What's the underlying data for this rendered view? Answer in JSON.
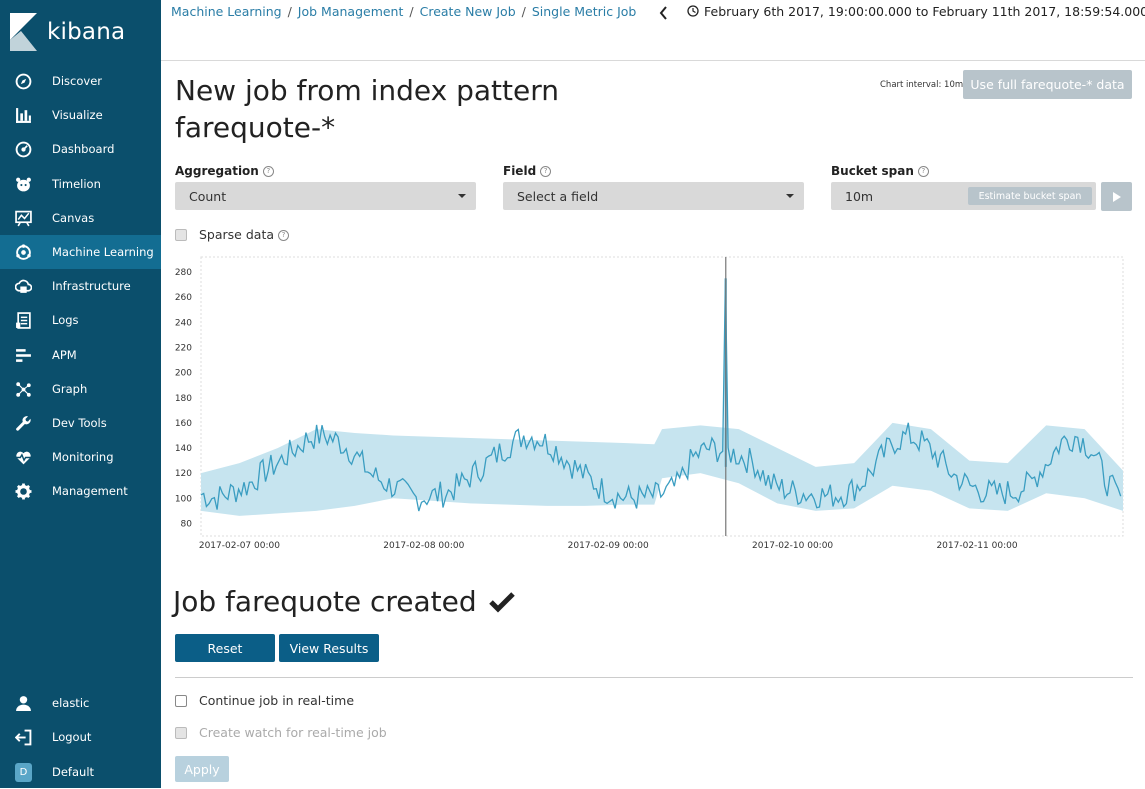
{
  "app": {
    "logo_text": "kibana"
  },
  "sidebar": {
    "items": [
      {
        "label": "Discover",
        "icon": "compass-icon"
      },
      {
        "label": "Visualize",
        "icon": "bar-chart-icon"
      },
      {
        "label": "Dashboard",
        "icon": "dashboard-icon"
      },
      {
        "label": "Timelion",
        "icon": "timelion-icon"
      },
      {
        "label": "Canvas",
        "icon": "canvas-icon"
      },
      {
        "label": "Machine Learning",
        "icon": "machine-learning-icon",
        "active": true
      },
      {
        "label": "Infrastructure",
        "icon": "infrastructure-icon"
      },
      {
        "label": "Logs",
        "icon": "logs-icon"
      },
      {
        "label": "APM",
        "icon": "apm-icon"
      },
      {
        "label": "Graph",
        "icon": "graph-icon"
      },
      {
        "label": "Dev Tools",
        "icon": "wrench-icon"
      },
      {
        "label": "Monitoring",
        "icon": "heartbeat-icon"
      },
      {
        "label": "Management",
        "icon": "gear-icon"
      }
    ],
    "bottom": [
      {
        "label": "elastic",
        "icon": "user-icon"
      },
      {
        "label": "Logout",
        "icon": "logout-icon"
      },
      {
        "label": "Default",
        "icon": "space-avatar",
        "avatar_letter": "D"
      }
    ]
  },
  "breadcrumb": {
    "items": [
      "Machine Learning",
      "Job Management",
      "Create New Job",
      "Single Metric Job"
    ],
    "separator": "/"
  },
  "time_picker": {
    "range": "February 6th 2017, 19:00:00.000 to February 11th 2017, 18:59:54.000"
  },
  "page": {
    "title": "New job from index pattern farequote-*",
    "chart_interval": "Chart interval: 10m",
    "use_full_button": "Use full farequote-* data"
  },
  "form": {
    "aggregation": {
      "label": "Aggregation",
      "value": "Count"
    },
    "field": {
      "label": "Field",
      "value": "Select a field"
    },
    "bucket_span": {
      "label": "Bucket span",
      "value": "10m",
      "estimate_button": "Estimate bucket span"
    },
    "sparse_data": {
      "label": "Sparse data",
      "checked": false
    }
  },
  "chart_data": {
    "type": "line",
    "x_tick_labels": [
      "2017-02-07 00:00",
      "2017-02-08 00:00",
      "2017-02-09 00:00",
      "2017-02-10 00:00",
      "2017-02-11 00:00"
    ],
    "y_ticks": [
      80,
      100,
      120,
      140,
      160,
      180,
      200,
      220,
      240,
      260,
      280
    ],
    "ylim": [
      70,
      292
    ],
    "xlim_hours": [
      -5,
      115
    ],
    "series_hours": [
      -5,
      -3,
      -1,
      1,
      3,
      5,
      7,
      9,
      11,
      13,
      15,
      17,
      19,
      21,
      23,
      25,
      27,
      29,
      31,
      33,
      35,
      37,
      39,
      41,
      43,
      45,
      47,
      49,
      51,
      53,
      55,
      57,
      59,
      61,
      63,
      65,
      67,
      69,
      71,
      73,
      75,
      77,
      79,
      81,
      83,
      85,
      87,
      89,
      91,
      93,
      95,
      97,
      99,
      101,
      103,
      105,
      107,
      109,
      111,
      113,
      115
    ],
    "series_values": [
      103,
      100,
      105,
      110,
      120,
      128,
      138,
      148,
      150,
      145,
      135,
      120,
      112,
      106,
      100,
      102,
      104,
      112,
      122,
      132,
      142,
      150,
      148,
      140,
      128,
      118,
      108,
      102,
      100,
      101,
      103,
      110,
      132,
      140,
      138,
      134,
      128,
      112,
      107,
      104,
      103,
      102,
      104,
      112,
      128,
      144,
      150,
      144,
      132,
      118,
      110,
      105,
      104,
      106,
      112,
      128,
      145,
      150,
      138,
      112,
      98
    ],
    "spike": {
      "hour": 63.3,
      "value": 275
    },
    "band_hours": [
      -5,
      0,
      5,
      10,
      15,
      20,
      25,
      30,
      35,
      40,
      45,
      50,
      54,
      55,
      60,
      65,
      70,
      75,
      80,
      85,
      90,
      95,
      100,
      105,
      110,
      115
    ],
    "band_upper": [
      120,
      128,
      140,
      155,
      152,
      150,
      149,
      148,
      147,
      146,
      145,
      144,
      143,
      155,
      158,
      155,
      140,
      125,
      128,
      160,
      155,
      130,
      128,
      158,
      155,
      122
    ],
    "band_lower": [
      90,
      86,
      88,
      90,
      94,
      100,
      98,
      96,
      95,
      94,
      94,
      95,
      95,
      116,
      120,
      112,
      96,
      90,
      92,
      110,
      106,
      92,
      90,
      104,
      100,
      90
    ],
    "marker_hour": 63.3,
    "colors": {
      "line": "#3a9dc1",
      "band": "#c6e4ef",
      "marker": "#777777"
    }
  },
  "result": {
    "created_title": "Job farequote created",
    "reset_button": "Reset",
    "view_results_button": "View Results",
    "continue_realtime": {
      "label": "Continue job in real-time",
      "checked": false
    },
    "create_watch": {
      "label": "Create watch for real-time job",
      "checked": false,
      "disabled": true
    },
    "apply_button": "Apply"
  }
}
